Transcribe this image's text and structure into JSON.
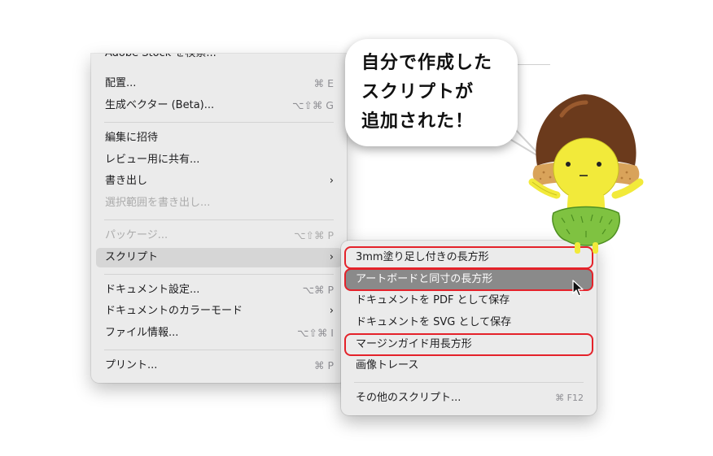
{
  "file_menu": {
    "items": [
      {
        "label": "Adobe Stock を検索...",
        "shortcut": "",
        "disabled": false,
        "cut": true
      },
      {
        "label": "配置...",
        "shortcut": "⌘ E"
      },
      {
        "label": "生成ベクター (Beta)...",
        "shortcut": "⌥⇧⌘ G"
      },
      {
        "label": "編集に招待",
        "shortcut": ""
      },
      {
        "label": "レビュー用に共有...",
        "shortcut": ""
      },
      {
        "label": "書き出し",
        "shortcut": "",
        "submenu": true
      },
      {
        "label": "選択範囲を書き出し...",
        "shortcut": "",
        "disabled": true
      },
      {
        "label": "パッケージ...",
        "shortcut": "⌥⇧⌘ P",
        "disabled": true
      },
      {
        "label": "スクリプト",
        "shortcut": "",
        "submenu": true,
        "highlighted": true
      },
      {
        "label": "ドキュメント設定...",
        "shortcut": "⌥⌘ P"
      },
      {
        "label": "ドキュメントのカラーモード",
        "shortcut": "",
        "submenu": true
      },
      {
        "label": "ファイル情報...",
        "shortcut": "⌥⇧⌘ I"
      },
      {
        "label": "プリント...",
        "shortcut": "⌘ P"
      }
    ],
    "submenu_arrow": "›"
  },
  "scripts_submenu": {
    "items": [
      {
        "label": "3mm塗り足し付きの長方形",
        "outlined": true
      },
      {
        "label": "アートボードと同寸の長方形",
        "outlined": true,
        "selected": true
      },
      {
        "label": "ドキュメントを PDF として保存"
      },
      {
        "label": "ドキュメントを SVG として保存"
      },
      {
        "label": "マージンガイド用長方形",
        "outlined": true
      },
      {
        "label": "画像トレース"
      },
      {
        "label": "その他のスクリプト...",
        "shortcut": "⌘ F12"
      }
    ]
  },
  "callout": {
    "lines": [
      "自分で作成した",
      "スクリプトが",
      "追加された！"
    ]
  },
  "colors": {
    "highlight_outline": "#e4222a",
    "selected_row": "#8a8a8a",
    "menu_bg": "#ebebeb",
    "mascot_shell": "#6b3a1c",
    "mascot_face": "#f2ea3a",
    "mascot_skirt": "#7fc241"
  },
  "icons": [
    "pointer-cursor-icon",
    "chestnut-mascot"
  ]
}
